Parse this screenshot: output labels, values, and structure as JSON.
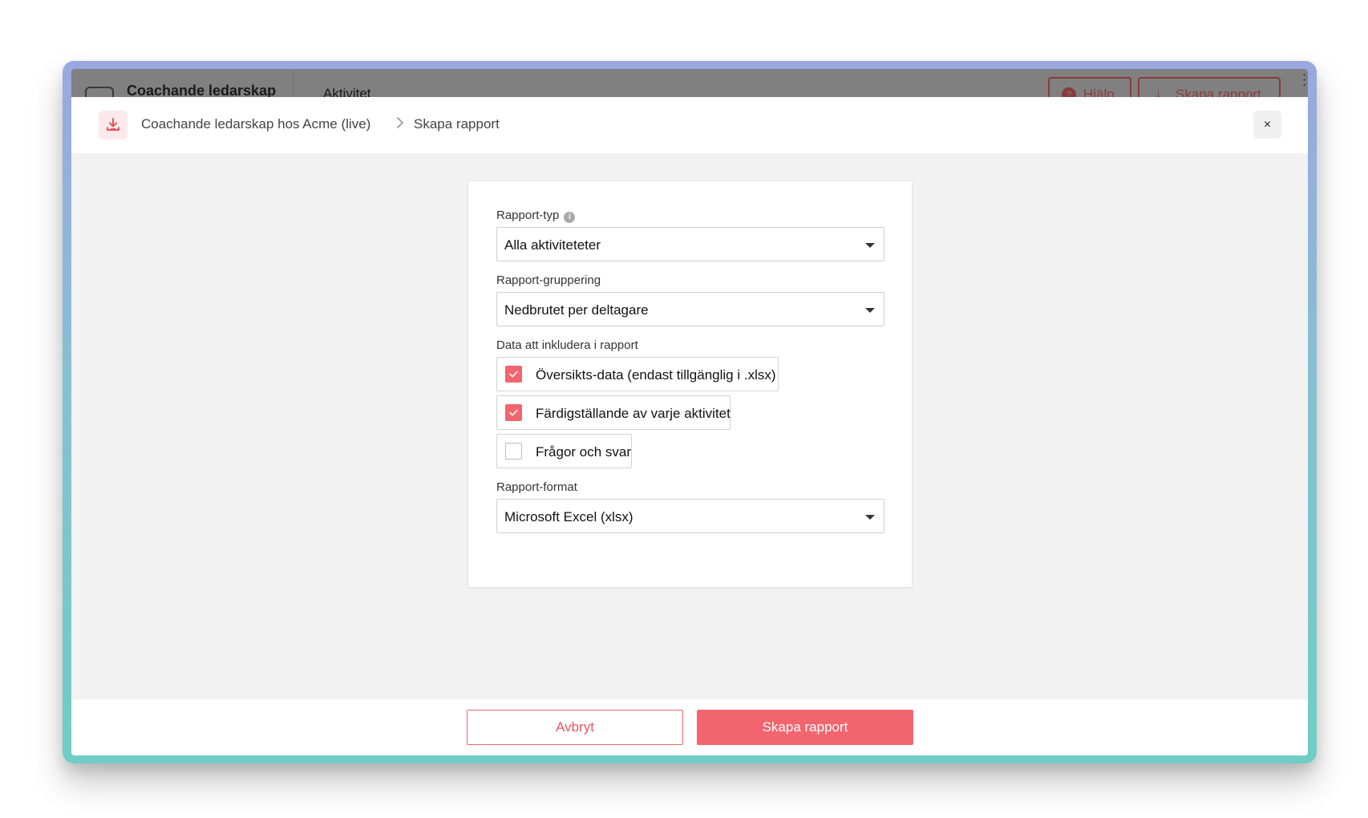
{
  "background_app": {
    "title": "Coachande ledarskap",
    "tab": "Aktivitet",
    "help_label": "Hjälp",
    "help_icon_glyph": "?",
    "create_label": "Skapa rapport"
  },
  "modal": {
    "header": {
      "icon": "download-icon",
      "breadcrumb": [
        "Coachande ledarskap hos Acme (live)",
        "Skapa rapport"
      ],
      "close_glyph": "×"
    },
    "form": {
      "report_type": {
        "label": "Rapport-typ",
        "info_glyph": "i",
        "value": "Alla aktiviteteter"
      },
      "report_grouping": {
        "label": "Rapport-gruppering",
        "value": "Nedbrutet per deltagare"
      },
      "data_include": {
        "label": "Data att inkludera i rapport",
        "options": [
          {
            "label": "Översikts-data (endast tillgänglig i .xlsx)",
            "checked": true
          },
          {
            "label": "Färdigställande av varje aktivitet",
            "checked": true
          },
          {
            "label": "Frågor och svar",
            "checked": false
          }
        ]
      },
      "report_format": {
        "label": "Rapport-format",
        "value": "Microsoft Excel (xlsx)"
      }
    },
    "footer": {
      "cancel_label": "Avbryt",
      "submit_label": "Skapa rapport"
    }
  },
  "colors": {
    "accent": "#f2656e",
    "accent_light": "#fde9ea"
  }
}
